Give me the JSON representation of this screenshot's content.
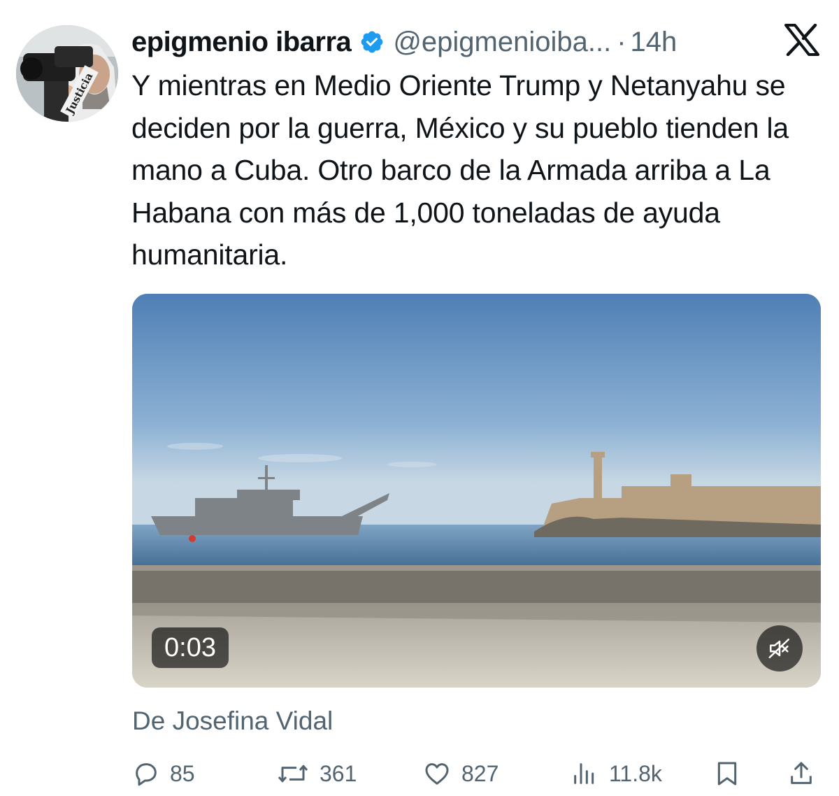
{
  "tweet": {
    "author": {
      "display_name": "epigmenio ibarra",
      "handle": "@epigmenioiba...",
      "verified": true,
      "avatar_caption": "Justicia"
    },
    "separator": "·",
    "time": "14h",
    "text": "Y mientras en Medio Oriente Trump y Netanyahu se deciden por la guerra, México y su pueblo tienden la mano a Cuba. Otro barco de la Armada arriba a La Habana con más de 1,000 toneladas de ayuda humanitaria.",
    "media": {
      "type": "video",
      "timestamp": "0:03",
      "muted": true
    },
    "attribution": "De Josefina Vidal",
    "actions": {
      "replies": "85",
      "reposts": "361",
      "likes": "827",
      "views": "11.8k"
    }
  },
  "colors": {
    "text": "#0f1419",
    "secondary": "#536471",
    "verified": "#1d9bf0"
  },
  "icons": {
    "verified": "verified-badge-icon",
    "brand": "x-logo-icon",
    "reply": "reply-icon",
    "repost": "repost-icon",
    "like": "heart-icon",
    "views": "views-icon",
    "bookmark": "bookmark-icon",
    "share": "share-icon",
    "mute": "muted-speaker-icon"
  }
}
